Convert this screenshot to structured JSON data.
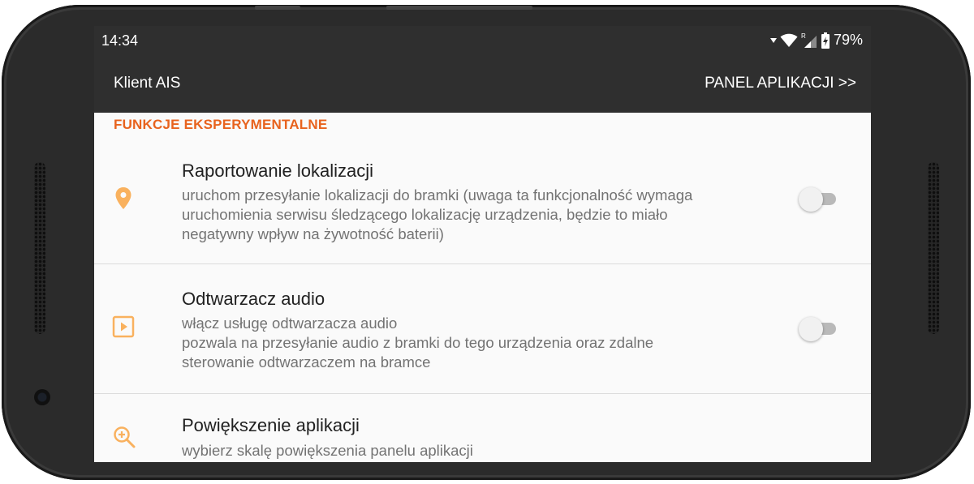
{
  "status_bar": {
    "time": "14:34",
    "battery": "79%",
    "icons": [
      "data-arrow-icon",
      "wifi-icon",
      "roaming-signal-icon",
      "battery-charging-icon"
    ]
  },
  "app_bar": {
    "title": "Klient AIS",
    "action": "PANEL APLIKACJI >>"
  },
  "section": {
    "header": "FUNKCJE EKSPERYMENTALNE",
    "accent_color": "#e8631e",
    "icon_color": "#f9b15e"
  },
  "preferences": [
    {
      "icon": "location-pin-icon",
      "title": "Raportowanie lokalizacji",
      "summary": "uruchom przesyłanie lokalizacji do bramki (uwaga ta funkcjonalność wymaga\nuruchomienia serwisu śledzącego lokalizację urządzenia, będzie to miało\nnegatywny wpływ na żywotność baterii)",
      "enabled": false
    },
    {
      "icon": "play-box-icon",
      "title": "Odtwarzacz audio",
      "summary": "włącz usługę odtwarzacza audio\npozwala na przesyłanie audio z bramki do tego urządzenia oraz zdalne\nsterowanie odtwarzaczem na bramce",
      "enabled": false
    },
    {
      "icon": "zoom-in-icon",
      "title": "Powiększenie aplikacji",
      "summary": "wybierz skalę powiększenia panelu aplikacji"
    }
  ]
}
